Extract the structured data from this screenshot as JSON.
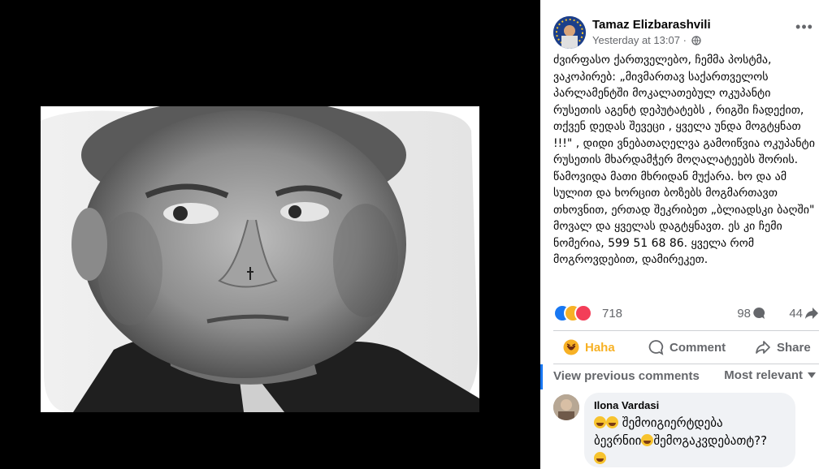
{
  "post": {
    "author": "Tamaz Elizbarashvili",
    "timestamp": "Yesterday at 13:07",
    "separator": "·",
    "more_icon": "more-horizontal-icon",
    "text": "ძვირფასო ქართველებო, ჩემმა პოსტმა, ვაკოპირებ: „მივმართავ საქართველოს პარლამენტში მოკალათებულ ოკუპანტი რუსეთის აგენტ დეპუტატებს , რიგში ჩადექით, თქვენ დედას შევეცი , ყველა უნდა მოგტყნათ !!!\" , დიდი ვნებათაღელვა გამოიწვია ოკუპანტი რუსეთის მხარდამჭერ მოღალატეებს შორის. წამოვიდა მათი მხრიდან მუქარა. ხო და ამ სულით და ხორცით ბოზებს მოგმართავთ თხოვნით, ერთად შეკრიბეთ „ბლიადსკი ბაღში\" მოვალ და ყველას დაგტყნავთ. ეს კი ჩემი ნომერია, 599 51 68 86. ყველა რომ მოგროვდებით, დამირეკეთ.",
    "reactions_count": "718",
    "comments_count": "98",
    "shares_count": "44"
  },
  "actions": {
    "haha": "Haha",
    "comment": "Comment",
    "share": "Share"
  },
  "comments_section": {
    "view_previous": "View previous comments",
    "sort": "Most relevant"
  },
  "comment": {
    "author": "Ilona Vardasi",
    "line1": "შემოიგიერტდება",
    "line2a": "ბევრნიი",
    "line2b": "შემოგაკვდებათტ??"
  },
  "colors": {
    "accent": "#1877f2",
    "haha": "#f7b125",
    "love": "#f33e58"
  }
}
